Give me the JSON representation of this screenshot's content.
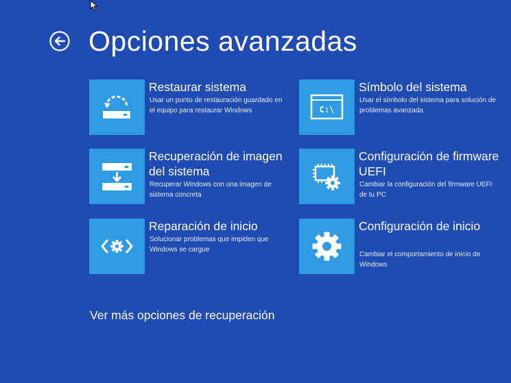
{
  "page": {
    "title": "Opciones avanzadas",
    "more_options": "Ver más opciones de recuperación"
  },
  "options": [
    {
      "icon": "system-restore-icon",
      "title": "Restaurar sistema",
      "desc": "Usar un punto de restauración guardado en el equipo para restaurar Windows"
    },
    {
      "icon": "command-prompt-icon",
      "title": "Símbolo del sistema",
      "desc": "Usar el símbolo del sistema para solución de problemas avanzada"
    },
    {
      "icon": "system-image-recovery-icon",
      "title": "Recuperación de imagen del sistema",
      "desc": "Recuperar Windows con una imagen de sistema concreta"
    },
    {
      "icon": "uefi-firmware-icon",
      "title": "Configuración de firmware UEFI",
      "desc": "Cambiar la configuración del firmware UEFI de tu PC"
    },
    {
      "icon": "startup-repair-icon",
      "title": "Reparación de inicio",
      "desc": "Solucionar problemas que impiden que Windows se cargue"
    },
    {
      "icon": "startup-settings-icon",
      "title": "Configuración de inicio",
      "desc": "Cambiar el comportamiento de inicio de Windows"
    }
  ],
  "icons": {
    "cmd_text": "C:\\"
  },
  "colors": {
    "background": "#1F4BB3",
    "tile": "#2F9BE2",
    "text": "#FFFFFF"
  }
}
